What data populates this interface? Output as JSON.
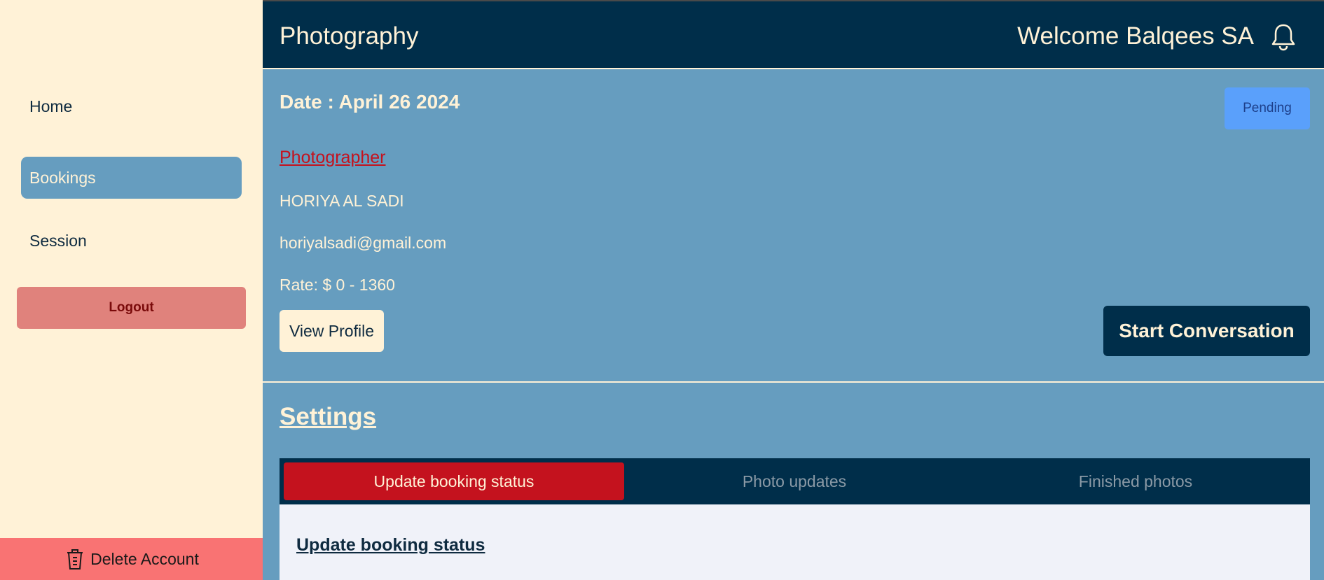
{
  "sidebar": {
    "items": [
      {
        "label": "Home"
      },
      {
        "label": "Bookings"
      },
      {
        "label": "Session"
      }
    ],
    "logout_label": "Logout",
    "delete_label": "Delete Account"
  },
  "header": {
    "title": "Photography",
    "welcome": "Welcome Balqees SA"
  },
  "booking": {
    "date_prefix": "Date : ",
    "date_value": "April 26 2024",
    "status": "Pending",
    "role": "Photographer",
    "name": "HORIYA AL SADI",
    "email": "horiyalsadi@gmail.com",
    "rate": "Rate: $ 0 - 1360",
    "view_profile_label": "View Profile",
    "start_conversation_label": "Start Conversation"
  },
  "settings": {
    "title": "Settings",
    "tabs": [
      {
        "label": "Update booking status"
      },
      {
        "label": "Photo updates"
      },
      {
        "label": "Finished photos"
      }
    ],
    "active_tab": "Update booking status",
    "panel_title": "Update booking status"
  },
  "colors": {
    "sidebar_bg": "#fff2d7",
    "main_bg": "#669dbf",
    "header_bg": "#002e4a",
    "accent_red": "#c4121e",
    "pending_blue": "#5aa0fb",
    "delete_bg": "#f97373"
  }
}
